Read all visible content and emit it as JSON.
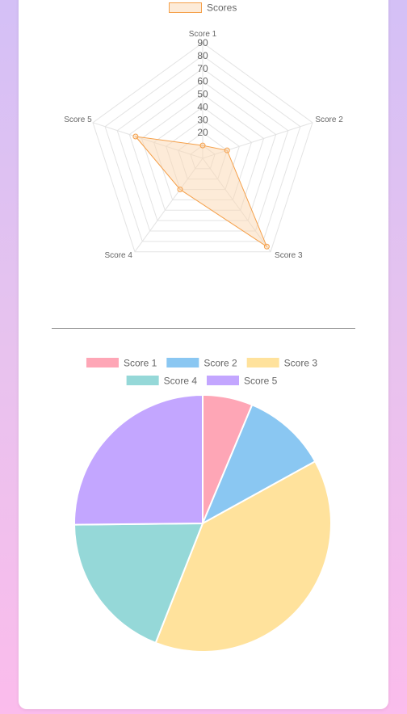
{
  "chart_data": [
    {
      "type": "radar",
      "labels": [
        "Score 1",
        "Score 2",
        "Score 3",
        "Score 4",
        "Score 5"
      ],
      "series": [
        {
          "name": "Scores",
          "values": [
            10,
            20,
            85,
            30,
            55
          ],
          "color": "#f5a04a",
          "fill": "rgba(252,216,178,0.5)"
        }
      ],
      "r_ticks": [
        20,
        30,
        40,
        50,
        60,
        70,
        80,
        90
      ],
      "r_range": [
        0,
        90
      ],
      "legend": "top",
      "grid": true
    },
    {
      "type": "pie",
      "categories": [
        "Score 1",
        "Score 2",
        "Score 3",
        "Score 4",
        "Score 5"
      ],
      "values": [
        10,
        17,
        62,
        30,
        40
      ],
      "colors": [
        "#fea6b6",
        "#8ac7f2",
        "#ffe29c",
        "#95d8d8",
        "#c3a6ff"
      ],
      "legend": "top"
    }
  ]
}
